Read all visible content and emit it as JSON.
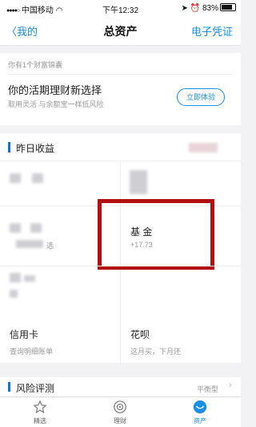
{
  "status_bar": {
    "carrier": "中国移动",
    "time": "下午12:32",
    "battery": "83%"
  },
  "nav": {
    "back_label": "我的",
    "title": "总资产",
    "right_label": "电子凭证"
  },
  "promo": {
    "tip": "你有1个财富锦囊",
    "headline": "你的活期理财新选择",
    "subtitle": "取用灵活 与余额宝一样低风险",
    "button_label": "立即体验"
  },
  "earnings": {
    "label": "昨日收益",
    "fund": {
      "title": "基  金",
      "value": "+17.73"
    },
    "partial_left_text": "选"
  },
  "credit": {
    "card": {
      "title": "信用卡",
      "subtitle": "查询明细账单"
    },
    "huabei": {
      "title": "花呗",
      "subtitle": "这月买，下月还"
    }
  },
  "risk": {
    "label": "风险评测",
    "value": "平衡型"
  },
  "tabs": [
    {
      "label": "精选",
      "icon": "star-icon",
      "active": false
    },
    {
      "label": "理财",
      "icon": "target-icon",
      "active": false
    },
    {
      "label": "资产",
      "icon": "asset-icon",
      "active": true
    }
  ],
  "colors": {
    "accent": "#1a8fe3",
    "highlight_box": "#b30f12"
  }
}
